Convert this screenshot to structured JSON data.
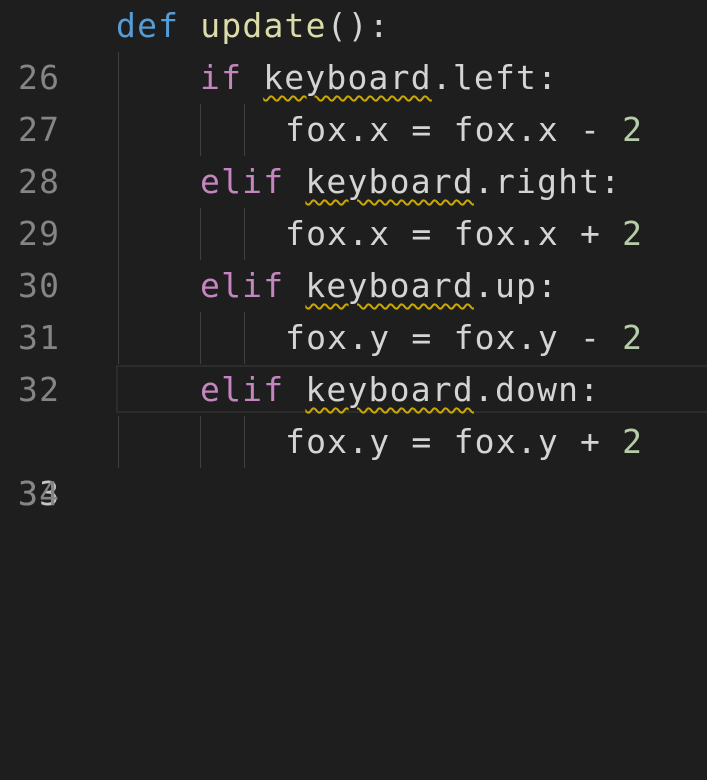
{
  "editor": {
    "lines": [
      {
        "number": "26",
        "tokens": {
          "kw": "def",
          "fn": "update",
          "rest": "():"
        }
      },
      {
        "number": "27",
        "tokens": {
          "kw": "if",
          "obj": "keyboard",
          "rest": ".left:"
        }
      },
      {
        "number": "28",
        "tokens": {
          "lhs": "fox.x",
          "op": "=",
          "rhs": "fox.x",
          "op2": "-",
          "num": "2"
        }
      },
      {
        "number": "29",
        "tokens": {
          "kw": "elif",
          "obj": "keyboard",
          "rest": ".right:"
        }
      },
      {
        "number": "30",
        "tokens": {
          "lhs": "fox.x",
          "op": "=",
          "rhs": "fox.x",
          "op2": "+",
          "num": "2"
        }
      },
      {
        "number": "31",
        "tokens": {
          "kw": "elif",
          "obj": "keyboard",
          "rest": ".up:"
        }
      },
      {
        "number": "32",
        "tokens": {
          "lhs": "fox.y",
          "op": "=",
          "rhs": "fox.y",
          "op2": "-",
          "num": "2"
        }
      },
      {
        "number": "33",
        "tokens": {
          "kw": "elif",
          "obj": "keyboard",
          "rest": ".down:"
        }
      },
      {
        "number": "34",
        "tokens": {
          "lhs": "fox.y",
          "op": "=",
          "rhs": "fox.y",
          "op2": "+",
          "num": "2"
        }
      }
    ],
    "current_line": "33",
    "colors": {
      "background": "#1e1e1e",
      "keyword_def": "#569cd6",
      "keyword_control": "#c586c0",
      "function": "#dcdcaa",
      "number": "#b5cea8",
      "warning_squiggle": "#cca700"
    }
  }
}
